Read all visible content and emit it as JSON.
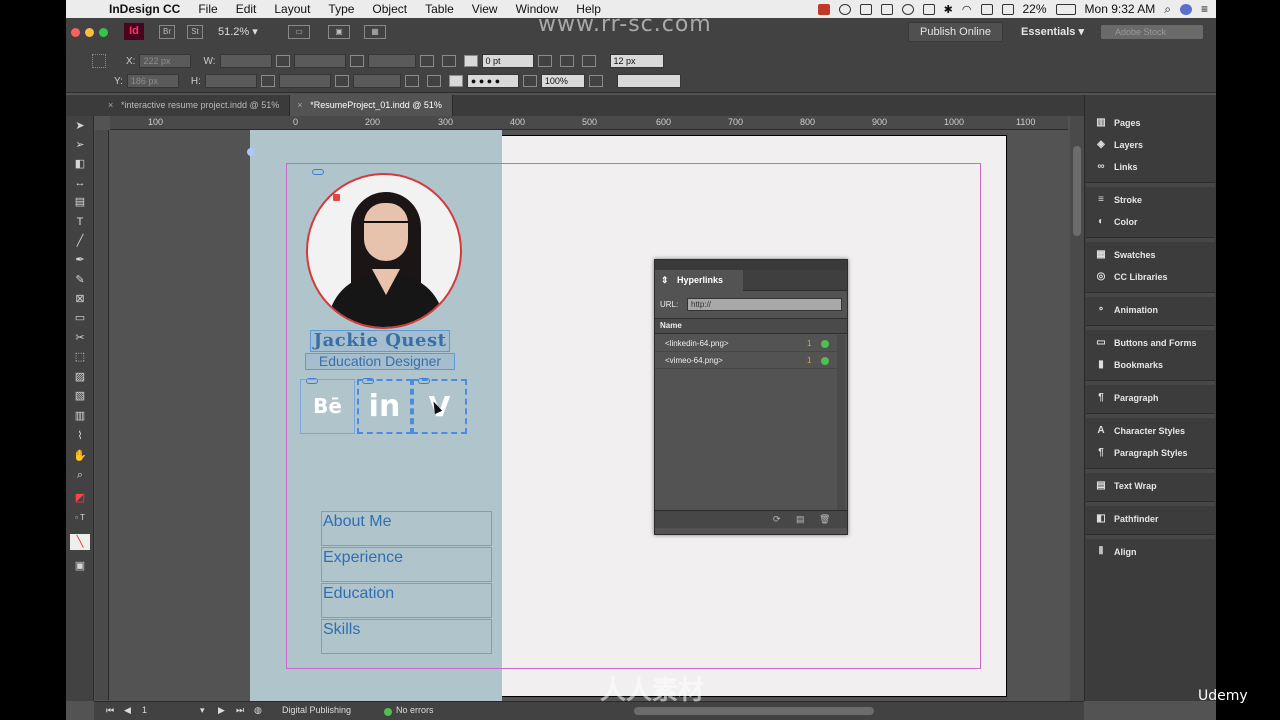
{
  "menubar": {
    "app_name": "InDesign CC",
    "items": [
      "File",
      "Edit",
      "Layout",
      "Type",
      "Object",
      "Table",
      "View",
      "Window",
      "Help"
    ],
    "battery": "22%",
    "clock": "Mon 9:32 AM"
  },
  "control": {
    "zoom": "51.2%",
    "publish_label": "Publish Online",
    "workspace": "Essentials",
    "search_placeholder": "Adobe Stock",
    "x_label": "X:",
    "x_value": "222 px",
    "y_label": "Y:",
    "y_value": "186 px",
    "w_label": "W:",
    "h_label": "H:",
    "stroke_weight": "0 pt",
    "opacity": "100%",
    "font_size": "12 px",
    "colors": {
      "bg": "#424242",
      "accent": "#ff3366"
    }
  },
  "tabs": [
    {
      "label": "*interactive resume project.indd @ 51%"
    },
    {
      "label": "*ResumeProject_01.indd @ 51%"
    }
  ],
  "ruler": {
    "h_labels": [
      "100",
      "0",
      "100",
      "200",
      "300",
      "400",
      "500",
      "600",
      "700",
      "800",
      "900",
      "1000",
      "1100"
    ]
  },
  "document": {
    "name": "Jackie Quest",
    "role": "Education Designer",
    "social": [
      "Bē",
      "in",
      "V"
    ],
    "menu": [
      "About Me",
      "Experience",
      "Education",
      "Skills"
    ],
    "colors": {
      "sidebar": "#b0c4cb",
      "page": "#f2eff1",
      "text": "#2f6eb0"
    }
  },
  "hyperlinks_panel": {
    "title": "Hyperlinks",
    "url_label": "URL:",
    "url_value": "http://",
    "col_name": "Name",
    "rows": [
      {
        "name": "<linkedin-64.png>",
        "count": "1"
      },
      {
        "name": "<vimeo-64.png>",
        "count": "1"
      }
    ]
  },
  "panels": [
    {
      "label": "Pages",
      "icon": "pages-icon"
    },
    {
      "label": "Layers",
      "icon": "layers-icon"
    },
    {
      "label": "Links",
      "icon": "links-icon"
    },
    {
      "label": "Stroke",
      "icon": "stroke-icon"
    },
    {
      "label": "Color",
      "icon": "color-icon"
    },
    {
      "label": "Swatches",
      "icon": "swatches-icon"
    },
    {
      "label": "CC Libraries",
      "icon": "cc-libraries-icon"
    },
    {
      "label": "Animation",
      "icon": "animation-icon"
    },
    {
      "label": "Buttons and Forms",
      "icon": "buttons-forms-icon"
    },
    {
      "label": "Bookmarks",
      "icon": "bookmarks-icon"
    },
    {
      "label": "Paragraph",
      "icon": "paragraph-icon"
    },
    {
      "label": "Character Styles",
      "icon": "character-styles-icon"
    },
    {
      "label": "Paragraph Styles",
      "icon": "paragraph-styles-icon"
    },
    {
      "label": "Text Wrap",
      "icon": "text-wrap-icon"
    },
    {
      "label": "Pathfinder",
      "icon": "pathfinder-icon"
    },
    {
      "label": "Align",
      "icon": "align-icon"
    }
  ],
  "status": {
    "page": "1",
    "preflight_profile": "Digital Publishing",
    "errors": "No errors"
  },
  "watermark": {
    "top": "www.rr-sc.com",
    "bottom": "人人素材",
    "brand": "Udemy"
  }
}
